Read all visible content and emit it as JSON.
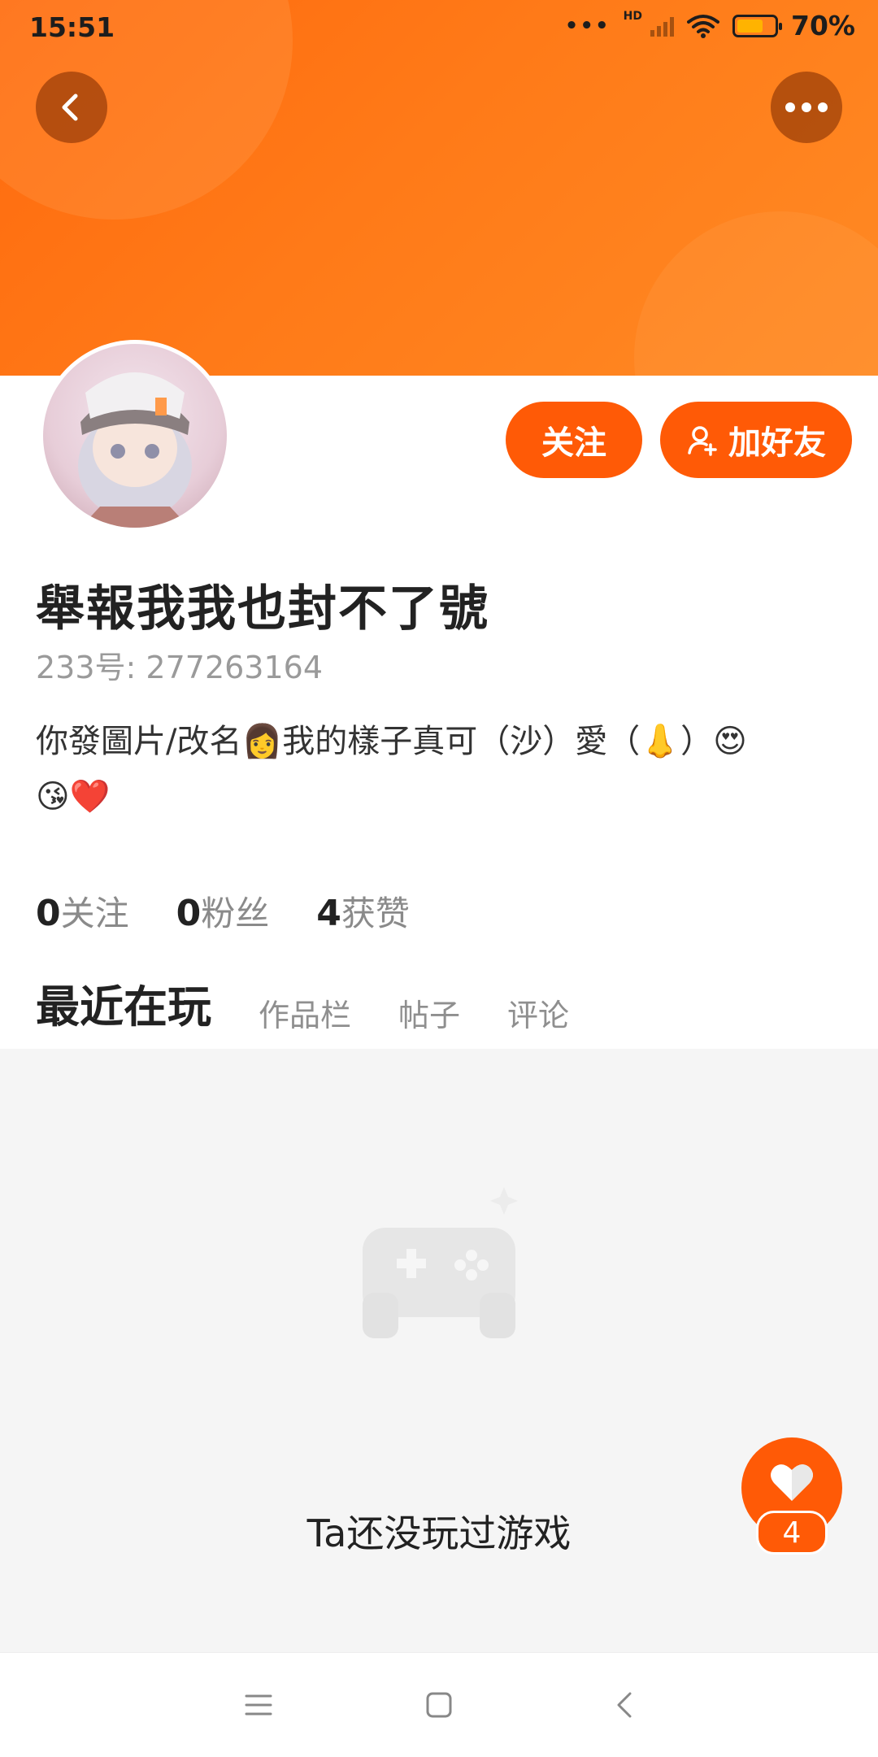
{
  "status_bar": {
    "time": "15:51",
    "signal_dots": "•••",
    "network_label": "HD",
    "battery_percent": "70%",
    "battery_level": 0.7
  },
  "header": {
    "back_icon": "chevron-left-icon",
    "more_icon": "more-dots-icon",
    "gradient_colors": [
      "#ff6a0e",
      "#ff8a24"
    ]
  },
  "profile": {
    "name": "舉報我我也封不了號",
    "uid": "233号: 277263164",
    "bio_line1": "你發圖片/改名👩我的樣子真可（沙）愛（👃）😍",
    "bio_line2": "😘❤️"
  },
  "actions": {
    "follow_label": "关注",
    "add_friend_label": "加好友",
    "accent_color": "#ff5a06"
  },
  "stats": [
    {
      "count": "0",
      "label": "关注"
    },
    {
      "count": "0",
      "label": "粉丝"
    },
    {
      "count": "4",
      "label": "获赞"
    }
  ],
  "tabs": [
    {
      "label": "最近在玩",
      "active": true
    },
    {
      "label": "作品栏",
      "active": false
    },
    {
      "label": "帖子",
      "active": false
    },
    {
      "label": "评论",
      "active": false
    }
  ],
  "empty_state": {
    "icon": "gamepad-icon",
    "text": "Ta还没玩过游戏"
  },
  "fab": {
    "icon": "heart-icon",
    "count": "4"
  },
  "nav_bar": {
    "menu_icon": "menu-icon",
    "home_icon": "home-square-icon",
    "back_icon": "back-chevron-icon"
  }
}
